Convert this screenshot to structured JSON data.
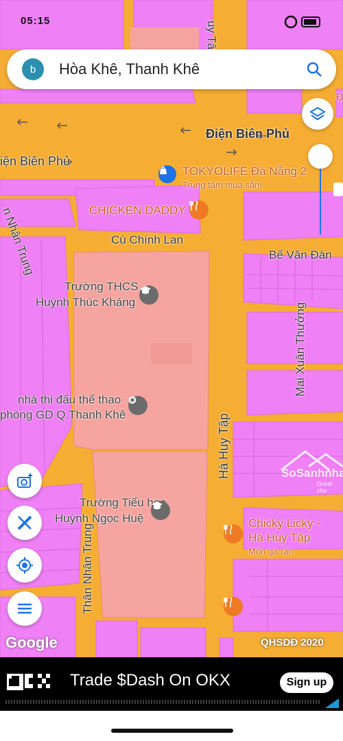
{
  "status_bar": {
    "time": "05:15"
  },
  "search": {
    "avatar_letter": "b",
    "query": "Hòa Khê, Thanh Khê"
  },
  "map": {
    "roads": {
      "dien_bien_phu_1": "Điện Biên Phủ",
      "dien_bien_phu_2": "iện Biên Phủ",
      "ha_huy_tap_top": "uy Tập",
      "ha_huy_tap": "Hà Huy Tập",
      "cu_chinh_lan": "Cù Chính Lan",
      "be_van_dan": "Bế Văn Đàn",
      "mai_xuan_thuong": "Mai Xuân Thưởng",
      "than_nhan_trung_top": "n Nhân Trung",
      "than_nhan_trung": "Thân Nhân Trung"
    },
    "pois": {
      "tokyolife_name": "TOKYOLIFE Đà Nẵng 2",
      "tokyolife_sub": "Trung tâm mua sắm",
      "chicken_daddy": "CHICKEN DADDY",
      "thcs_line1": "Trường THCS",
      "thcs_line2": "Huỳnh Thúc Kháng",
      "nhathidau_line1": "nhà thi đấu thể thao",
      "nhathidau_line2": "phòng GD Q.Thanh Khê",
      "tieuhoc_line1": "Trường Tiểu học",
      "tieuhoc_line2": "Huỳnh Ngọc Huệ",
      "chicky_line1": "Chicky Licky -",
      "chicky_line2": "Hà Huy Tập",
      "chicky_sub": "Món gà rán"
    },
    "watermark": "SoSanhnha",
    "watermark_sub": "Great cho",
    "google_logo": "Google",
    "layer_label": "QHSDĐ 2020",
    "edge_label": "Đ"
  },
  "ad": {
    "brand": "OKX",
    "text": "Trade $Dash On OKX",
    "button": "Sign up"
  },
  "colors": {
    "land_pink": "#ef80f5",
    "road_orange": "#f6ad33",
    "public_salmon": "#f6a4a0",
    "poi_orange": "#ee7a24",
    "poi_blue": "#1a73e8",
    "accent": "#1a73e8"
  },
  "icons": [
    "search-icon",
    "layers-icon",
    "camera-add-icon",
    "measure-icon",
    "my-location-icon",
    "menu-icon",
    "school-icon",
    "restaurant-icon",
    "shopping-icon",
    "place-icon"
  ]
}
